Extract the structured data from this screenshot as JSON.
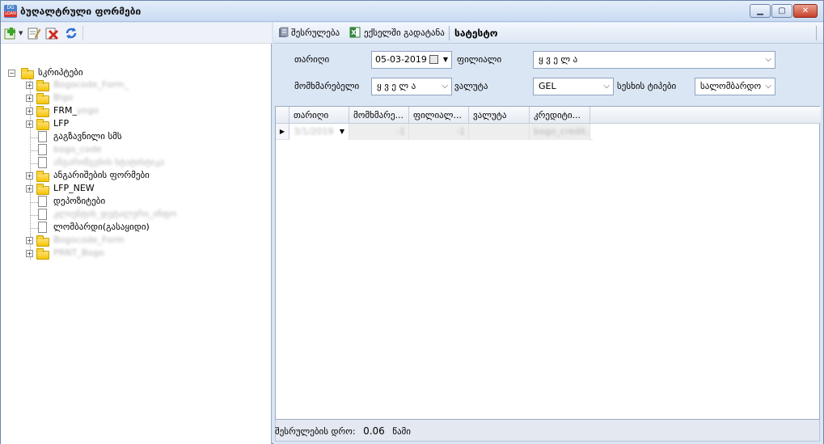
{
  "window": {
    "title": "ბუღალტრული ფორმები",
    "icon_text_top": "DG",
    "icon_text_bottom": "LOAN"
  },
  "tree": {
    "root": "სკრიპტები",
    "nodes": [
      {
        "kind": "folder",
        "label": "Bogocode_Form_",
        "blurred": true
      },
      {
        "kind": "folder",
        "label": "Bigo",
        "blurred": true
      },
      {
        "kind": "folder",
        "label": "FRM_",
        "suffix": "yogo",
        "blurred": false
      },
      {
        "kind": "folder",
        "label": "LFP",
        "blurred": false
      },
      {
        "kind": "doc",
        "label": "გაგზავნილი სმს",
        "blurred": false
      },
      {
        "kind": "doc",
        "label": "bogo_code",
        "blurred": true
      },
      {
        "kind": "doc",
        "label": "ანგარიშგების სტატისტიკა",
        "blurred": true
      },
      {
        "kind": "folder",
        "label": "ანგარიშების ფორმები",
        "blurred": false
      },
      {
        "kind": "folder",
        "label": "LFP_NEW",
        "blurred": false
      },
      {
        "kind": "doc",
        "label": "დეპოზიტები",
        "blurred": false
      },
      {
        "kind": "doc",
        "label": "კლიენტის_დეტალური_ინფო",
        "blurred": true
      },
      {
        "kind": "doc",
        "label": "ლომბარდი(გასაყიდი)",
        "blurred": false
      },
      {
        "kind": "folder",
        "label": "Bogocode_Form",
        "blurred": true
      },
      {
        "kind": "folder",
        "label": "PRNT_Bogo",
        "blurred": true
      }
    ]
  },
  "toolbar": {
    "run_label": "შესრულება",
    "excel_label": "ექსელში გადატანა",
    "report_title": "სატესტო"
  },
  "filters": {
    "date_label": "თარიღი",
    "date_value": "05-03-2019",
    "branch_label": "ფილიალი",
    "branch_value": "ყ ვ ე ლ ა",
    "user_label": "მომხმარებელი",
    "user_value": "ყ ვ ე ლ ა",
    "currency_label": "ვალუტა",
    "currency_value": "GEL",
    "system_type_label": "სესხის ტიპები",
    "system_type_value": "სალომბარდო"
  },
  "grid": {
    "columns": [
      "თარიღი",
      "მომხმარე...",
      "ფილიალ...",
      "ვალუტა",
      "კრედიტი..."
    ],
    "rows": [
      {
        "date": "3/1/2019",
        "user": "-1",
        "branch": "-1",
        "currency": "",
        "credit": "bogo_credit..."
      }
    ]
  },
  "status": {
    "label": "შესრულების დრო:",
    "value": "0.06",
    "unit": "წამი"
  }
}
